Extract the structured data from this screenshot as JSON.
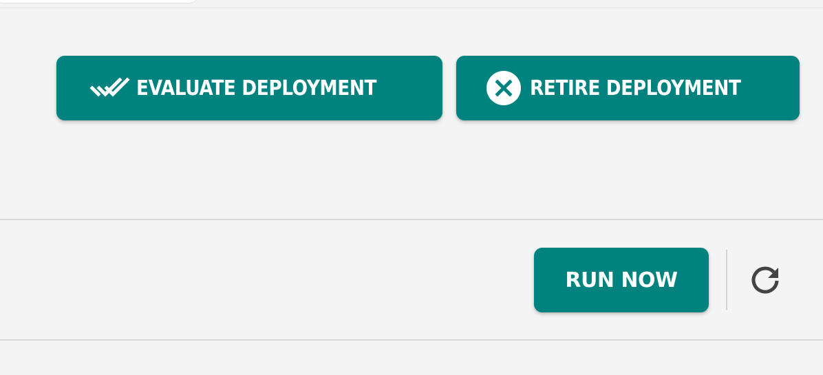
{
  "accent_color": "#00827f",
  "top_toolbar": {
    "evaluate_button": {
      "label": "EVALUATE DEPLOYMENT",
      "icon": "double-check-icon"
    },
    "retire_button": {
      "label": "RETIRE DEPLOYMENT",
      "icon": "close-circle-icon"
    }
  },
  "bottom_toolbar": {
    "run_now_button": {
      "label": "RUN NOW"
    },
    "refresh_button": {
      "icon": "refresh-icon"
    }
  }
}
